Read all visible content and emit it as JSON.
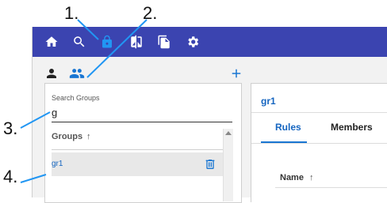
{
  "callouts": [
    "1.",
    "2.",
    "3.",
    "4."
  ],
  "toolbar": {
    "icons": [
      "home-icon",
      "search-icon",
      "lock-icon",
      "compare-icon",
      "copy-icon",
      "settings-icon"
    ]
  },
  "side_tabs": [
    "user-icon",
    "group-icon"
  ],
  "search": {
    "label": "Search Groups",
    "value": "g"
  },
  "groups": {
    "header": "Groups",
    "sort_indicator": "↑",
    "items": [
      {
        "name": "gr1"
      }
    ]
  },
  "detail": {
    "title": "gr1",
    "tabs": [
      "Rules",
      "Members"
    ],
    "active_tab": "Rules",
    "table_header": "Name",
    "sort_indicator": "↑"
  },
  "colors": {
    "topbar": "#3b44b0",
    "accent": "#1976d2",
    "link": "#1565c0",
    "lock_icon": "#2196f3"
  }
}
